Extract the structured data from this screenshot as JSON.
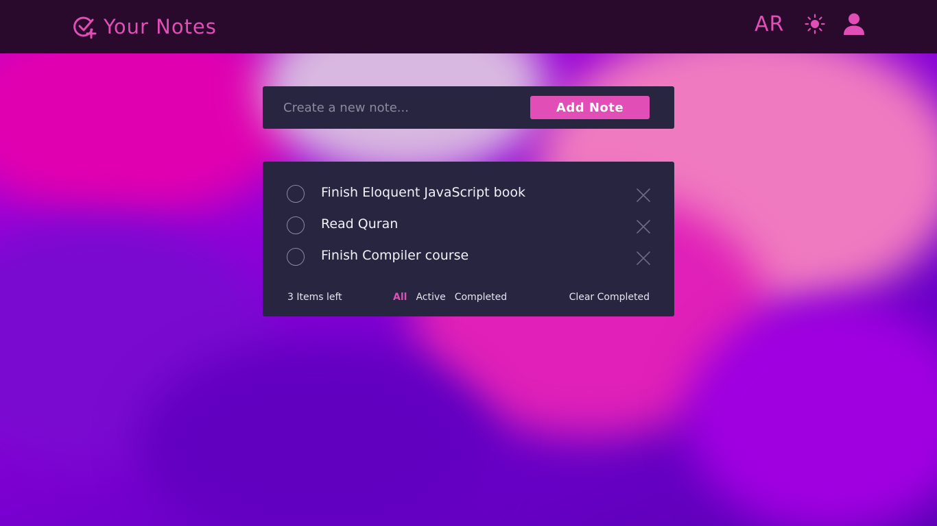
{
  "header": {
    "title": "Your Notes",
    "language": "AR",
    "brand_icon": "check-plus-icon",
    "theme_icon": "sun-icon",
    "user_icon": "user-icon"
  },
  "create": {
    "placeholder": "Create a new note...",
    "value": "",
    "add_label": "Add Note"
  },
  "notes": [
    {
      "text": "Finish Eloquent JavaScript book",
      "completed": false
    },
    {
      "text": "Read Quran",
      "completed": false
    },
    {
      "text": "Finish Compiler course",
      "completed": false
    }
  ],
  "footer": {
    "items_left": "3 Items left",
    "filters": [
      "All",
      "Active",
      "Completed"
    ],
    "active_filter": "All",
    "clear_label": "Clear Completed"
  },
  "colors": {
    "accent": "#e04eb6",
    "topbar": "#2a0a2c",
    "card": "#272540"
  }
}
